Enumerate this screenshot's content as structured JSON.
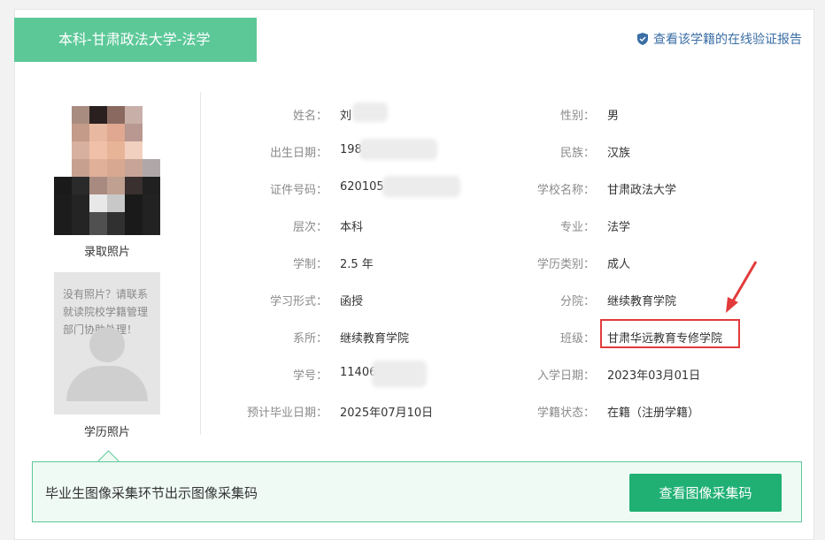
{
  "header": {
    "title": "本科-甘肃政法大学-法学",
    "verify_link": "查看该学籍的在线验证报告"
  },
  "photos": {
    "admission_caption": "录取照片",
    "education_caption": "学历照片",
    "no_photo_message": "没有照片？请联系就读院校学籍管理部门协助处理！"
  },
  "left_fields": [
    {
      "label": "姓名：",
      "value": "刘"
    },
    {
      "label": "出生日期：",
      "value": "198"
    },
    {
      "label": "证件号码：",
      "value": "620105"
    },
    {
      "label": "层次：",
      "value": "本科"
    },
    {
      "label": "学制：",
      "value": "2.5 年"
    },
    {
      "label": "学习形式：",
      "value": "函授"
    },
    {
      "label": "系所：",
      "value": "继续教育学院"
    },
    {
      "label": "学号：",
      "value": "11406"
    },
    {
      "label": "预计毕业日期：",
      "value": "2025年07月10日"
    }
  ],
  "right_fields": [
    {
      "label": "性别：",
      "value": "男"
    },
    {
      "label": "民族：",
      "value": "汉族"
    },
    {
      "label": "学校名称：",
      "value": "甘肃政法大学"
    },
    {
      "label": "专业：",
      "value": "法学"
    },
    {
      "label": "学历类别：",
      "value": "成人"
    },
    {
      "label": "分院：",
      "value": "继续教育学院"
    },
    {
      "label": "班级：",
      "value": "甘肃华远教育专修学院"
    },
    {
      "label": "入学日期：",
      "value": "2023年03月01日"
    },
    {
      "label": "学籍状态：",
      "value": "在籍（注册学籍）"
    }
  ],
  "bottom": {
    "text": "毕业生图像采集环节出示图像采集码",
    "button": "查看图像采集码"
  },
  "colors": {
    "accent": "#5cc898",
    "button": "#20b074",
    "highlight": "#e23b3b"
  }
}
